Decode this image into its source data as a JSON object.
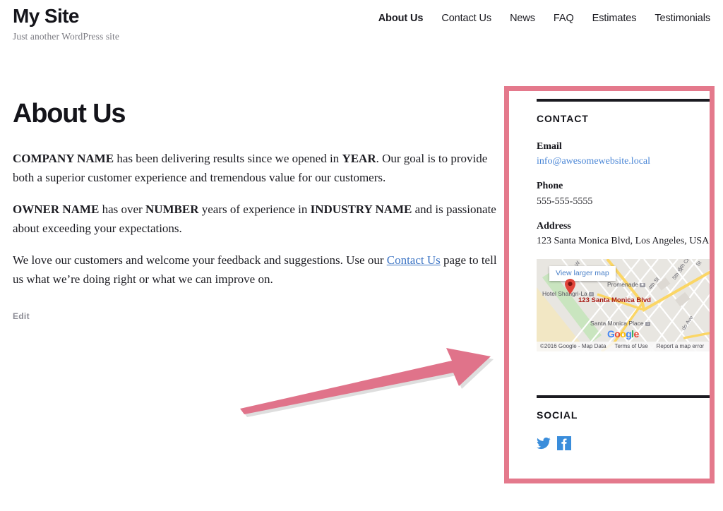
{
  "header": {
    "site_title": "My Site",
    "tagline": "Just another WordPress site",
    "nav": [
      {
        "label": "About Us",
        "active": true
      },
      {
        "label": "Contact Us",
        "active": false
      },
      {
        "label": "News",
        "active": false
      },
      {
        "label": "FAQ",
        "active": false
      },
      {
        "label": "Estimates",
        "active": false
      },
      {
        "label": "Testimonials",
        "active": false
      }
    ]
  },
  "main": {
    "page_title": "About Us",
    "paragraph_1": {
      "bold_1": "COMPANY NAME",
      "text_1": " has been delivering results since we opened in ",
      "bold_2": "YEAR",
      "text_2": ". Our goal is to provide both a superior customer experience and tremendous value for our customers."
    },
    "paragraph_2": {
      "bold_1": "OWNER NAME",
      "text_1": " has over ",
      "bold_2": "NUMBER",
      "text_2": " years of experience in ",
      "bold_3": "INDUSTRY NAME",
      "text_3": " and is passionate about exceeding your expectations."
    },
    "paragraph_3": {
      "text_1": "We love our customers and welcome your feedback and suggestions. Use our ",
      "link": "Contact Us",
      "text_2": " page to tell us what we’re doing right or what we can improve on."
    },
    "edit_label": "Edit"
  },
  "sidebar": {
    "contact_widget": {
      "title": "CONTACT",
      "email_label": "Email",
      "email_value": "info@awesomewebsite.local",
      "phone_label": "Phone",
      "phone_value": "555-555-5555",
      "address_label": "Address",
      "address_value": "123 Santa Monica Blvd, Los Angeles, USA"
    },
    "map": {
      "view_larger_label": "View larger map",
      "marker_label": "123 Santa Monica Blvd",
      "poi_hotel": "Hotel Shangri-La",
      "poi_promenade": "Promenade",
      "poi_santa_monica_place": "Santa Monica Place",
      "street_4th": "4th St",
      "street_5th": "5th St",
      "street_5th_ct": "5th Ct",
      "street_st": "St",
      "street_ave": "do Ave",
      "logo_letters": [
        "G",
        "o",
        "o",
        "g",
        "l",
        "e"
      ],
      "attribution": "©2016 Google - Map Data",
      "terms_label": "Terms of Use",
      "report_label": "Report a map error"
    },
    "social_widget": {
      "title": "SOCIAL",
      "icons": [
        {
          "name": "twitter-icon",
          "color": "#3a8ddb"
        },
        {
          "name": "facebook-icon",
          "color": "#3a8ddb"
        }
      ]
    }
  },
  "annotations": {
    "highlight_color": "#e4798c",
    "arrow_color": "#e0738a"
  }
}
